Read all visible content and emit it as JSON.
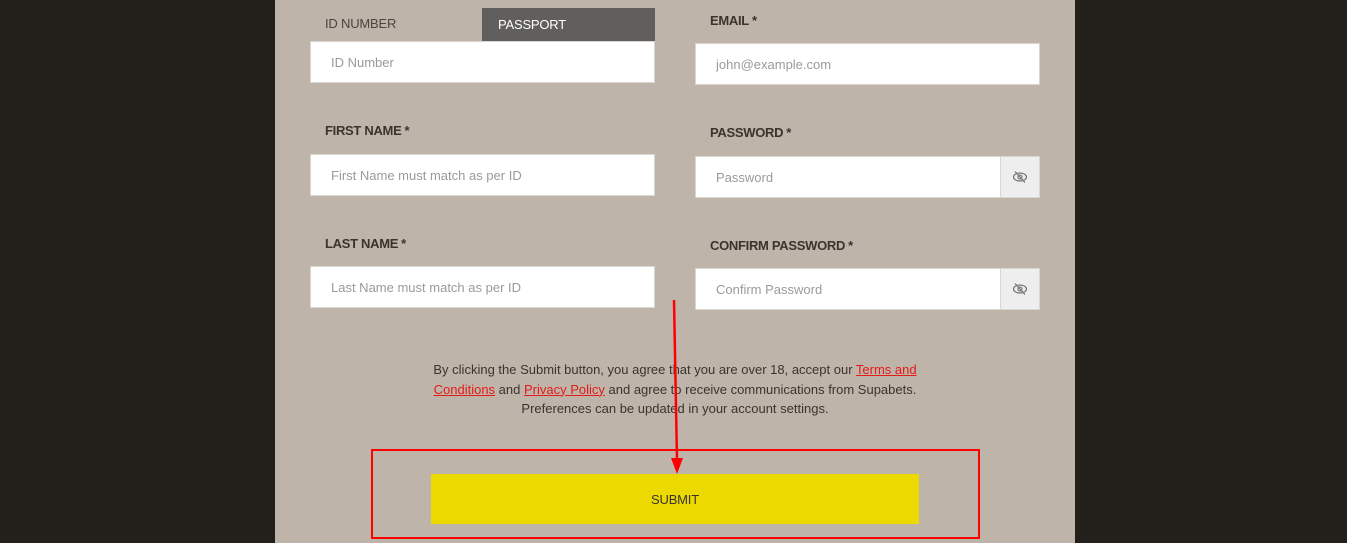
{
  "id_tabs": {
    "id_number_label": "ID NUMBER",
    "passport_label": "PASSPORT",
    "active": "passport"
  },
  "fields": {
    "id_number": {
      "placeholder": "ID Number",
      "value": ""
    },
    "first_name": {
      "label": "FIRST NAME",
      "required_mark": "*",
      "placeholder": "First Name must match as per ID",
      "value": ""
    },
    "last_name": {
      "label": "LAST NAME",
      "required_mark": "*",
      "placeholder": "Last Name must match as per ID",
      "value": ""
    },
    "email": {
      "label": "EMAIL",
      "required_mark": "*",
      "placeholder": "john@example.com",
      "value": ""
    },
    "password": {
      "label": "PASSWORD",
      "required_mark": "*",
      "placeholder": "Password",
      "value": "",
      "toggle_icon": "eye-slash-icon"
    },
    "confirm_password": {
      "label": "CONFIRM PASSWORD",
      "required_mark": "*",
      "placeholder": "Confirm Password",
      "value": "",
      "toggle_icon": "eye-slash-icon"
    }
  },
  "consent": {
    "text_1": "By clicking the Submit button, you agree that you are over 18, accept our ",
    "terms_link": "Terms and Conditions",
    "text_2": " and ",
    "privacy_link": "Privacy Policy",
    "text_3": " and agree to receive communications from Supabets. Preferences can be updated in your account settings."
  },
  "submit_label": "SUBMIT",
  "colors": {
    "page_bg": "#231f1b",
    "panel_bg": "#bfb4aa",
    "active_tab": "#615f5e",
    "submit": "#ecd900",
    "link": "#e41b17",
    "annotation": "#ff0000"
  }
}
